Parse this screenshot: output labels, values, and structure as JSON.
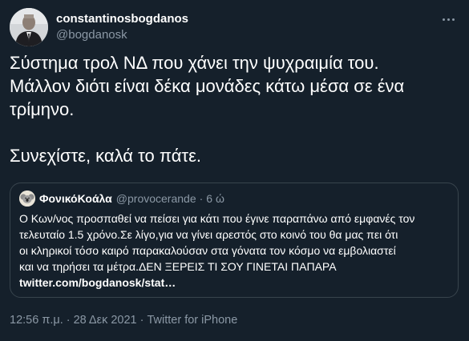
{
  "author": {
    "display_name": "constantinosbogdanos",
    "handle": "@bogdanosk"
  },
  "tweet": {
    "text": "Σύστημα τρολ ΝΔ που χάνει την ψυχραιμία του.\nΜάλλον διότι είναι δέκα μονάδες κάτω μέσα σε ένα\nτρίμηνο.\n\nΣυνεχίστε, καλά το πάτε."
  },
  "quote": {
    "display_name": "ΦονικόΚοάλα",
    "handle": "@provocerande",
    "separator": "·",
    "time": "6 ώ",
    "text": "Ο Κων/νος προσπαθεί να πείσει για κάτι που έγινε παραπάνω από εμφανές τον\nτελευταίο 1.5 χρόνο.Σε λίγο,για να γίνει αρεστός στο κοινό του θα μας πει ότι\nοι κληρικοί τόσο καιρό παρακαλούσαν στα γόνατα τον κόσμο να εμβολιαστεί\nκαι να τηρήσει τα μέτρα.ΔΕΝ ΞΕΡΕΙΣ ΤΙ ΣΟΥ ΓΙΝΕΤΑΙ ΠΑΠΑΡΑ",
    "link": "twitter.com/bogdanosk/stat…"
  },
  "meta": {
    "time": "12:56 π.μ.",
    "dot": "·",
    "date": "28 Δεκ 2021",
    "source": "Twitter for iPhone"
  },
  "colors": {
    "background": "#15202b",
    "text_primary": "#ffffff",
    "text_secondary": "#8b98a5",
    "border": "#38444d"
  },
  "icons": {
    "more": "more-horizontal-icon"
  }
}
